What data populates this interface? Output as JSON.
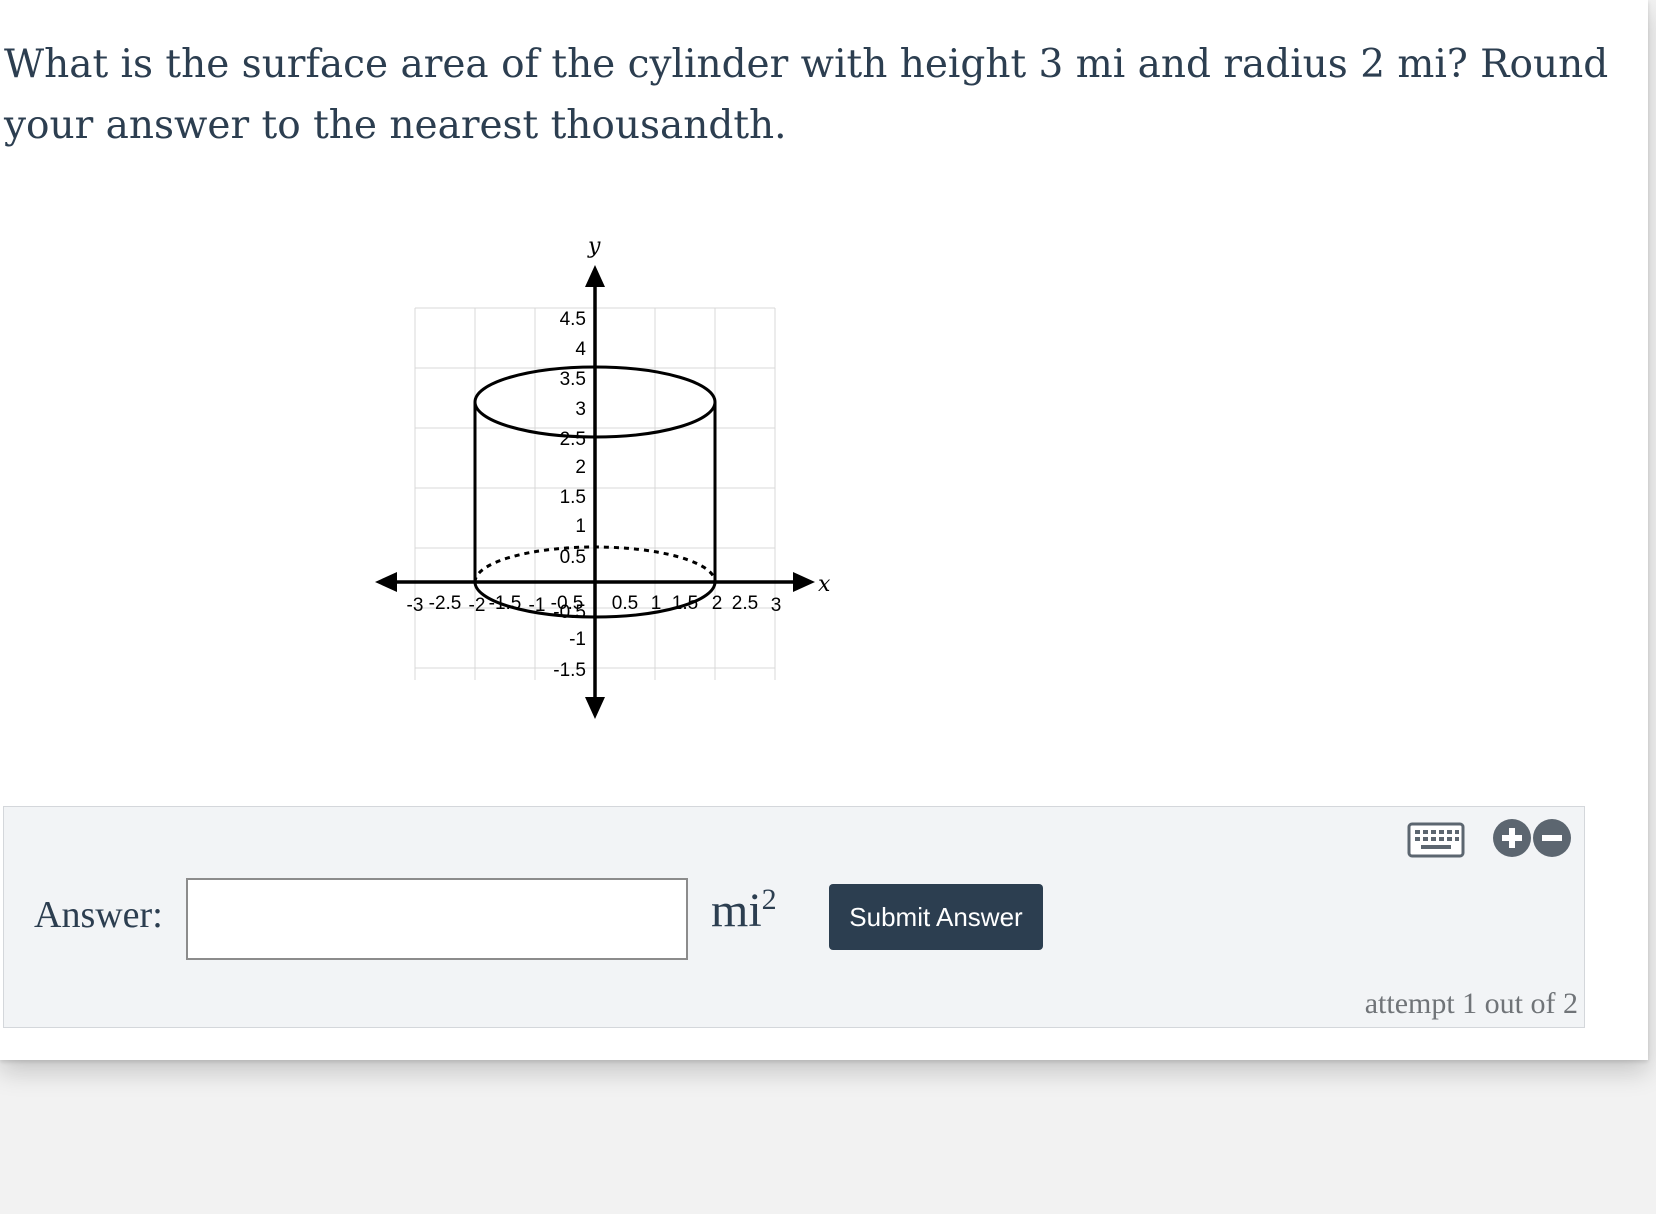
{
  "question": {
    "text": "What is the surface area of the cylinder with height 3 mi and radius 2 mi? Round your answer to the nearest thousandth."
  },
  "graph": {
    "x_axis_label": "x",
    "y_axis_label": "y",
    "x_ticks": [
      "-3",
      "-2.5",
      "-2",
      "-1.5",
      "-1",
      "-0.5",
      "0.5",
      "1",
      "1.5",
      "2",
      "2.5",
      "3"
    ],
    "y_ticks": [
      "4.5",
      "4",
      "3.5",
      "3",
      "2.5",
      "2",
      "1.5",
      "1",
      "0.5",
      "-0.5",
      "-1",
      "-1.5"
    ],
    "cylinder": {
      "radius": 2,
      "height": 3
    }
  },
  "answer": {
    "label": "Answer:",
    "input_value": "",
    "unit": "mi",
    "unit_exponent": "2",
    "submit_label": "Submit Answer",
    "attempt_text": "attempt 1 out of 2"
  },
  "icons": {
    "keyboard": "keyboard-icon",
    "zoom_in": "plus-circle-icon",
    "zoom_out": "minus-circle-icon"
  }
}
